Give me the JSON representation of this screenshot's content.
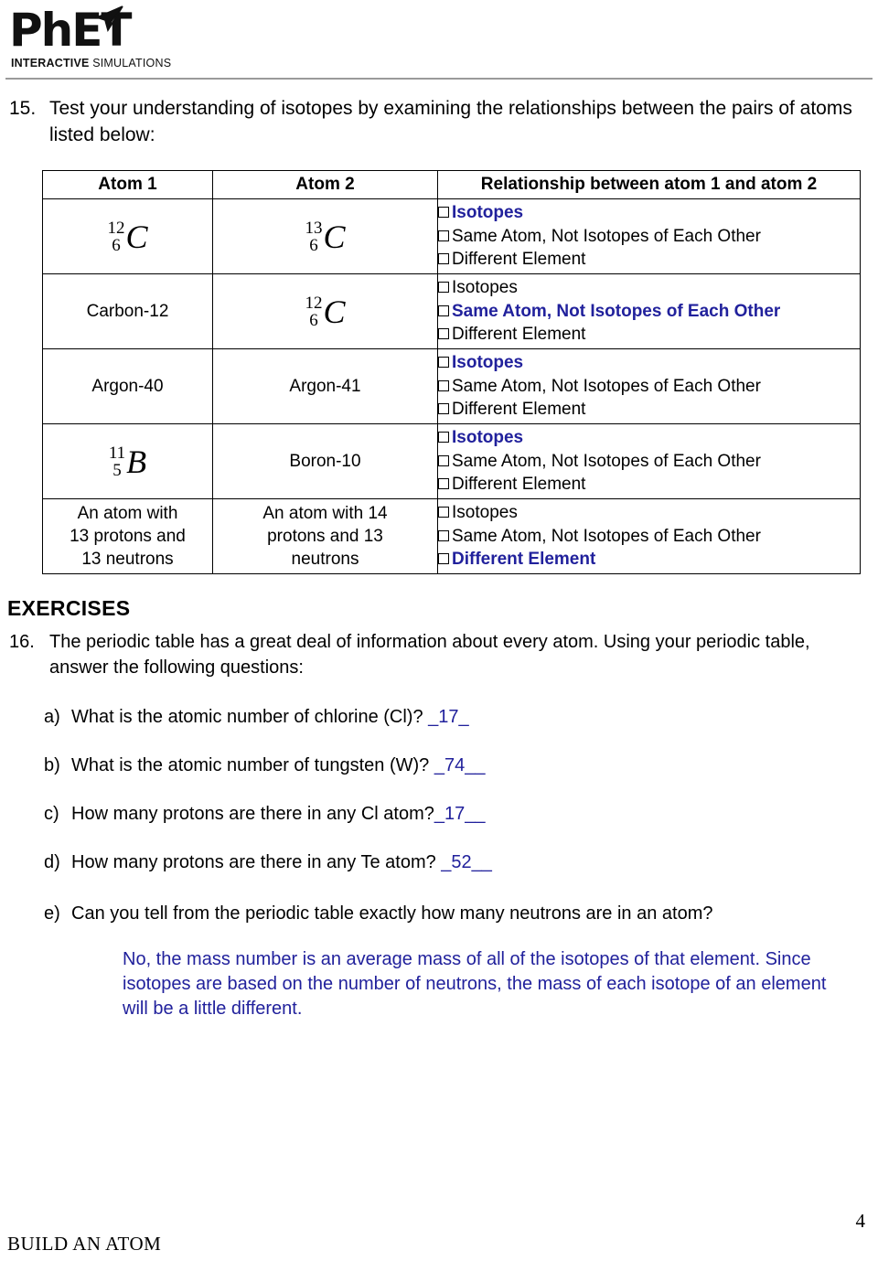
{
  "header": {
    "logo_main": "PhET",
    "logo_sub_bold": "INTERACTIVE",
    "logo_sub_light": " SIMULATIONS",
    "logo_icon": "paper-plane-icon"
  },
  "question15": {
    "number": "15.",
    "text": "Test your understanding of isotopes by examining the relationships between the pairs of atoms listed below:"
  },
  "table": {
    "headers": [
      "Atom 1",
      "Atom 2",
      "Relationship between atom 1 and atom 2"
    ],
    "option_labels": [
      "Isotopes",
      "Same Atom, Not Isotopes of Each Other",
      "Different Element"
    ],
    "rows": [
      {
        "atom1": {
          "type": "isotope",
          "mass": "12",
          "atomic": "6",
          "symbol": "C"
        },
        "atom2": {
          "type": "isotope",
          "mass": "13",
          "atomic": "6",
          "symbol": "C"
        },
        "options": [
          {
            "label": "Isotopes",
            "selected": true
          },
          {
            "label": "Same Atom, Not Isotopes of Each Other",
            "selected": false
          },
          {
            "label": "Different Element",
            "selected": false
          }
        ]
      },
      {
        "atom1": {
          "type": "text",
          "lines": [
            "Carbon-12"
          ]
        },
        "atom2": {
          "type": "isotope",
          "mass": "12",
          "atomic": "6",
          "symbol": "C"
        },
        "options": [
          {
            "label": "Isotopes",
            "selected": false
          },
          {
            "label": "Same Atom, Not Isotopes of Each Other",
            "selected": true
          },
          {
            "label": "Different Element",
            "selected": false
          }
        ]
      },
      {
        "atom1": {
          "type": "text",
          "lines": [
            "Argon-40"
          ]
        },
        "atom2": {
          "type": "text",
          "lines": [
            "Argon-41"
          ]
        },
        "options": [
          {
            "label": "Isotopes",
            "selected": true
          },
          {
            "label": "Same Atom, Not Isotopes of Each Other",
            "selected": false
          },
          {
            "label": "Different Element",
            "selected": false
          }
        ]
      },
      {
        "atom1": {
          "type": "isotope",
          "mass": "11",
          "atomic": "5",
          "symbol": "B"
        },
        "atom2": {
          "type": "text",
          "lines": [
            "Boron-10"
          ]
        },
        "options": [
          {
            "label": "Isotopes",
            "selected": true
          },
          {
            "label": "Same Atom, Not Isotopes of Each Other",
            "selected": false
          },
          {
            "label": "Different Element",
            "selected": false
          }
        ]
      },
      {
        "atom1": {
          "type": "text",
          "lines": [
            "An atom with",
            "13 protons and",
            "13 neutrons"
          ]
        },
        "atom2": {
          "type": "text",
          "lines": [
            "An atom with 14",
            "protons and 13",
            "neutrons"
          ]
        },
        "options": [
          {
            "label": "Isotopes",
            "selected": false
          },
          {
            "label": "Same Atom, Not Isotopes of Each Other",
            "selected": false
          },
          {
            "label": "Different Element",
            "selected": true
          }
        ]
      }
    ]
  },
  "exercises": {
    "title": "EXERCISES",
    "question16": {
      "number": "16.",
      "text": "The periodic table has a great deal of information about every atom.  Using your periodic table, answer the following questions:",
      "sub_questions": [
        {
          "label": "a)",
          "text": "What is the atomic number of chlorine (Cl)?",
          "answer": "_17_"
        },
        {
          "label": "b)",
          "text": "What is the atomic number of tungsten (W)?",
          "answer": "_74__"
        },
        {
          "label": "c)",
          "text": "How many protons are there in any Cl atom?",
          "answer": "_17__"
        },
        {
          "label": "d)",
          "text": "How many protons are there in any Te atom?",
          "answer": "_52__"
        },
        {
          "label": "e)",
          "text": "Can you tell from the periodic table exactly how many neutrons are in an atom?",
          "answer": ""
        }
      ],
      "e_answer": "No, the mass number is an average mass of all of the isotopes of that element. Since isotopes are based on the number of neutrons, the mass of each isotope of an element will be a little different."
    }
  },
  "footer": {
    "title": "BUILD AN ATOM",
    "page_number": "4"
  },
  "colors": {
    "answer_blue": "#21219c",
    "rule_gray": "#9a9a9a",
    "text_black": "#000000"
  }
}
